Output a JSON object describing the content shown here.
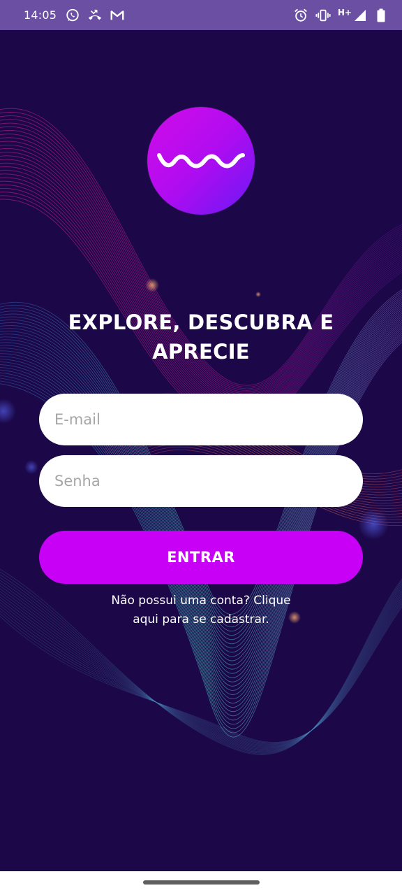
{
  "status_bar": {
    "time": "14:05",
    "left_icons": [
      "whatsapp-icon",
      "missed-call-icon",
      "gmail-icon"
    ],
    "right_icons": [
      "alarm-icon",
      "vibrate-icon",
      "signal-icon",
      "battery-icon"
    ],
    "network": "H+",
    "background": "#6a4fa3"
  },
  "logo": {
    "icon": "wave-icon",
    "gradient": [
      "#d10be8",
      "#6b18f5"
    ]
  },
  "headline": {
    "line1": "EXPLORE, DESCUBRA E",
    "line2": "APRECIE"
  },
  "form": {
    "email_placeholder": "E-mail",
    "password_placeholder": "Senha",
    "submit_label": "ENTRAR",
    "submit_color": "#c800f5"
  },
  "signup": {
    "line1": "Não possui uma conta? Clique",
    "line2": "aqui para se cadastrar."
  },
  "colors": {
    "background": "#1c0748",
    "accent": "#c800f5"
  }
}
